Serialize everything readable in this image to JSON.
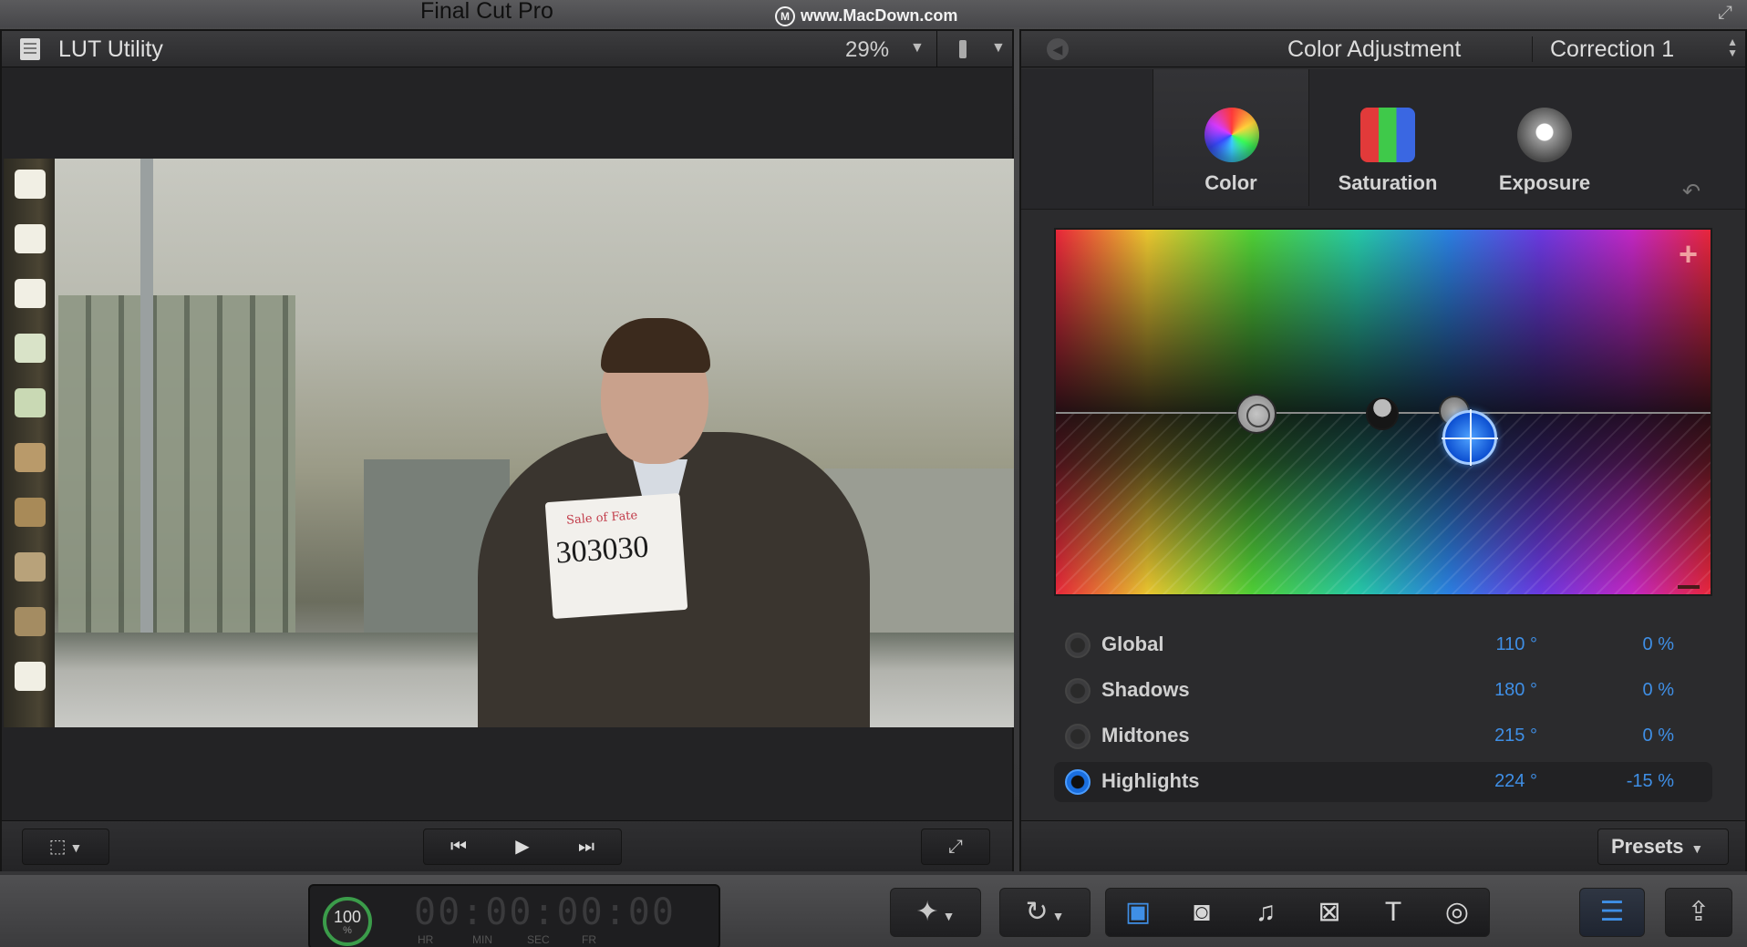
{
  "app": {
    "title": "Final Cut Pro",
    "watermark": "www.MacDown.com",
    "watermark_logo": "M"
  },
  "viewer": {
    "clip_name": "LUT Utility",
    "zoom": "29%",
    "paper_top_text": "Sale of Fate",
    "paper_number": "303030"
  },
  "inspector": {
    "title": "Color Adjustment",
    "correction": "Correction 1",
    "tabs": [
      {
        "label": "Color",
        "icon": "color-wheel-icon"
      },
      {
        "label": "Saturation",
        "icon": "saturation-icon"
      },
      {
        "label": "Exposure",
        "icon": "exposure-icon"
      }
    ],
    "active_tab": "Color",
    "ranges": [
      {
        "name": "Global",
        "angle": "110 °",
        "percent": "0 %"
      },
      {
        "name": "Shadows",
        "angle": "180 °",
        "percent": "0 %"
      },
      {
        "name": "Midtones",
        "angle": "215 °",
        "percent": "0 %"
      },
      {
        "name": "Highlights",
        "angle": "224 °",
        "percent": "-15 %"
      }
    ],
    "active_range": "Highlights",
    "presets_label": "Presets"
  },
  "toolbar": {
    "timecode": "00:00:00:00",
    "timecode_labels": [
      "HR",
      "MIN",
      "SEC",
      "FR"
    ],
    "gauge_value": "100",
    "gauge_unit": "%"
  },
  "colors": {
    "accent": "#3f8fe6",
    "gauge": "#3b9c4a"
  }
}
